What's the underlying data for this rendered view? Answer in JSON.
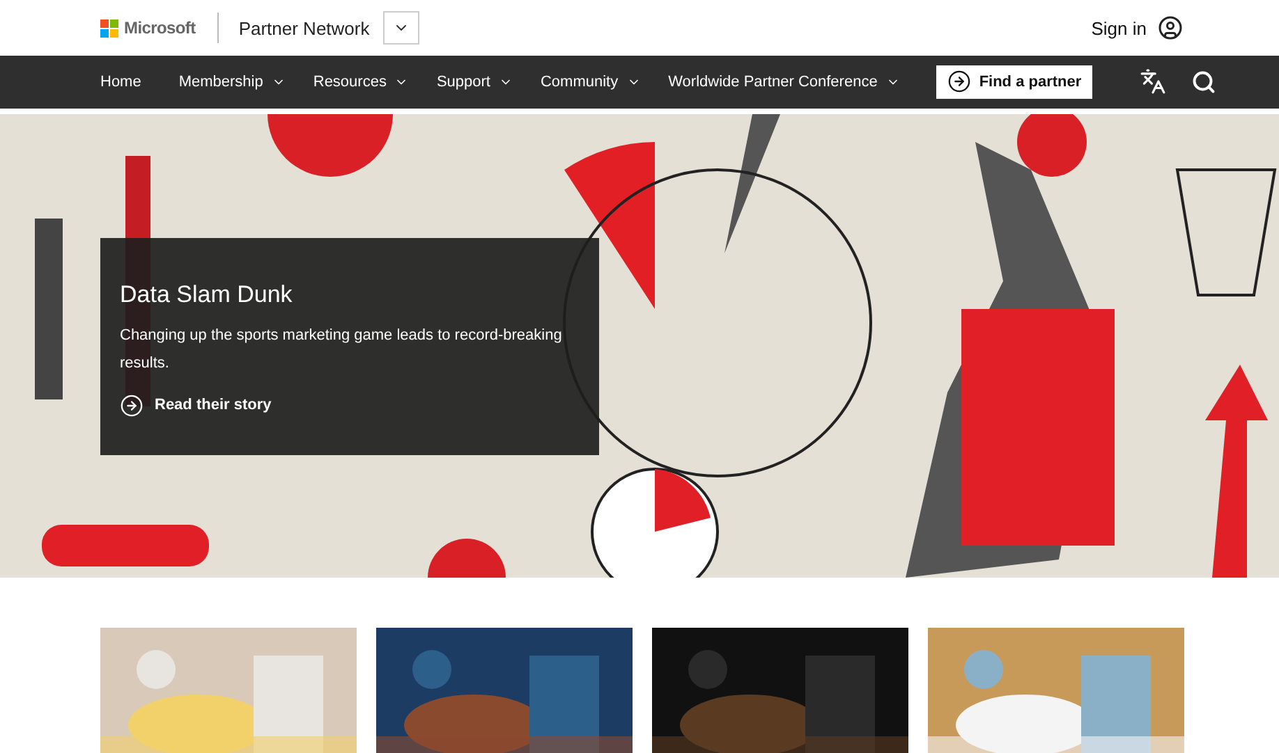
{
  "header": {
    "brand": "Microsoft",
    "site": "Partner Network",
    "sign_in": "Sign in"
  },
  "nav": {
    "items": [
      {
        "label": "Home",
        "has_menu": false
      },
      {
        "label": "Membership",
        "has_menu": true
      },
      {
        "label": "Resources",
        "has_menu": true
      },
      {
        "label": "Support",
        "has_menu": true
      },
      {
        "label": "Community",
        "has_menu": true
      },
      {
        "label": "Worldwide Partner Conference",
        "has_menu": true
      }
    ],
    "cta": "Find a partner"
  },
  "hero": {
    "kind": "picture",
    "title": "Data Slam Dunk",
    "body": "Changing up the sports marketing game leads to record-breaking results.",
    "link": "Read their story"
  }
}
